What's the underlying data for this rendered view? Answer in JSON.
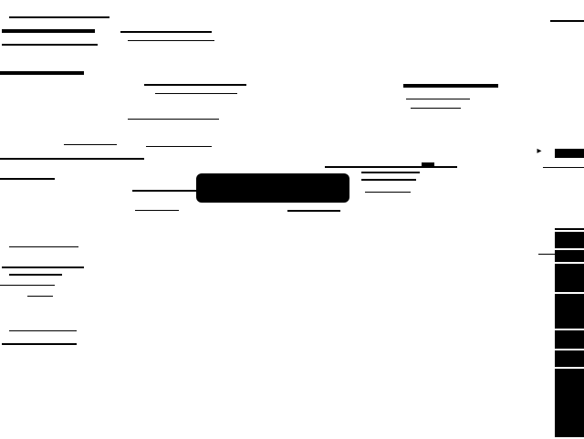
{
  "window": {
    "title": ""
  },
  "header": {
    "left_lines": [],
    "right_search_placeholder": ""
  },
  "content": {
    "headline": "",
    "subhead": "",
    "items": []
  },
  "toolbar": {
    "close_label": ""
  },
  "right_panel": {
    "sections": [],
    "colors": {
      "panel": "#000000",
      "background": "#ffffff"
    }
  }
}
